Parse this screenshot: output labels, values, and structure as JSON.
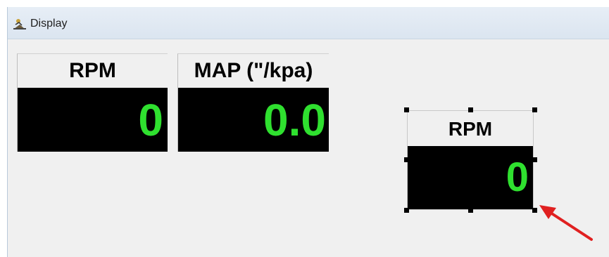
{
  "window": {
    "title": "Display",
    "icon": "display-app-icon"
  },
  "gauges": [
    {
      "label": "RPM",
      "value": "0"
    },
    {
      "label": "MAP (\"/kpa)",
      "value": "0.0"
    },
    {
      "label": "RPM",
      "value": "0",
      "selected": true
    }
  ],
  "annotation": {
    "arrow_color": "#e02020"
  },
  "colors": {
    "display_bg": "#000000",
    "display_text": "#2fe02f",
    "titlebar": "#dbe5f0",
    "client_bg": "#f0f0f0"
  }
}
